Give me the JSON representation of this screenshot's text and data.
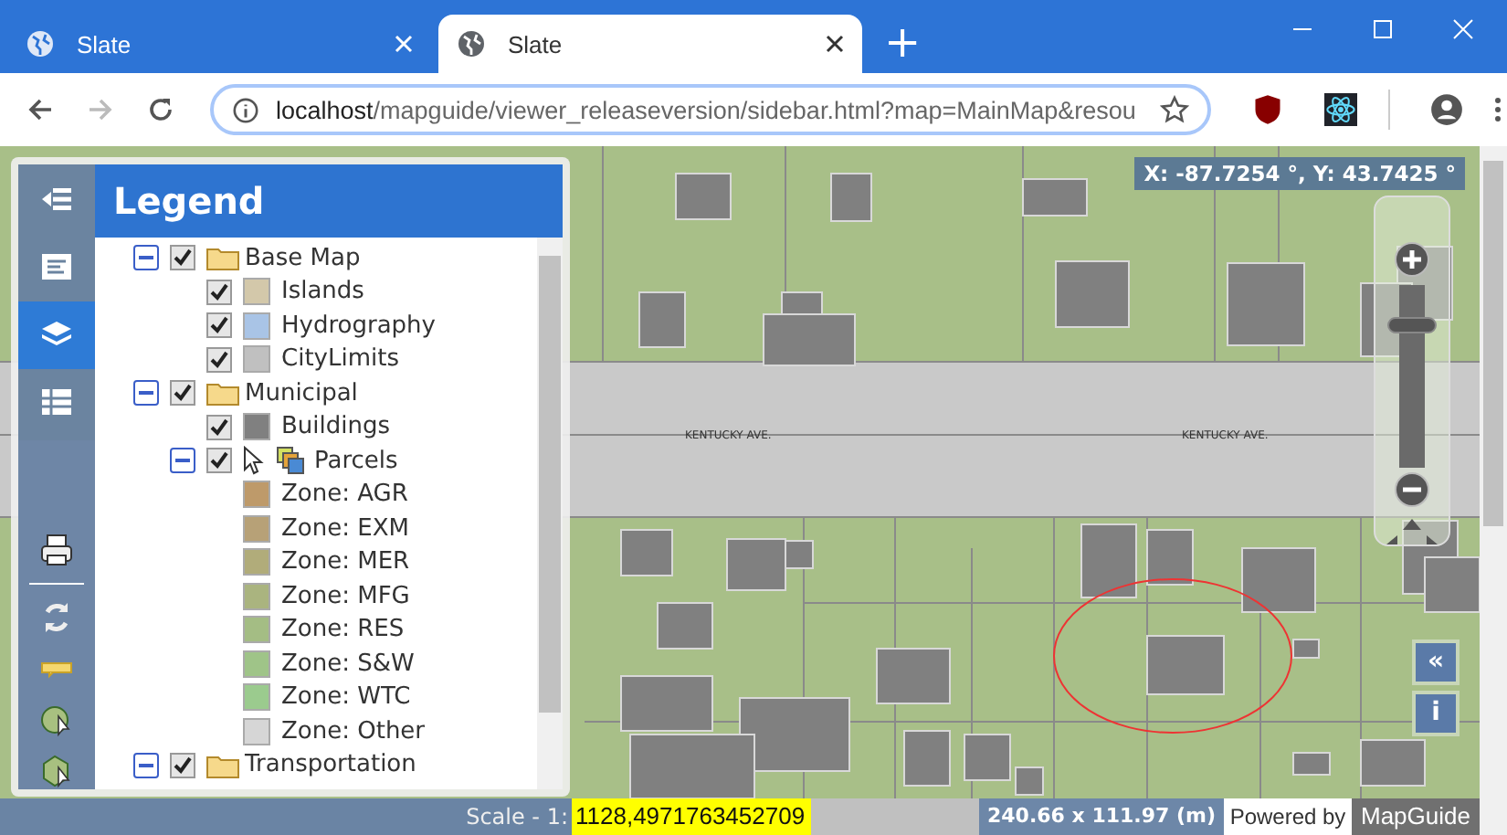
{
  "browser": {
    "tabs": [
      {
        "title": "Slate",
        "selected": false
      },
      {
        "title": "Slate",
        "selected": true
      }
    ],
    "new_tab": "+",
    "url": {
      "host": "localhost",
      "path": "/mapguide/viewer_releaseversion/sidebar.html?map=MainMap&resou"
    }
  },
  "sidebar": {
    "buttons": [
      {
        "kind": "collapse",
        "selected": false
      },
      {
        "kind": "info",
        "selected": false
      },
      {
        "kind": "layers",
        "selected": true
      },
      {
        "kind": "table",
        "selected": false
      }
    ],
    "tools": [
      {
        "kind": "print"
      },
      {
        "kind": "refresh"
      },
      {
        "kind": "tooltip"
      },
      {
        "kind": "select-circle"
      },
      {
        "kind": "select-polygon"
      }
    ]
  },
  "legend": {
    "title": "Legend",
    "items": [
      {
        "kind": "group",
        "label": "Base Map",
        "expanded": true,
        "checked": true,
        "children": [
          {
            "kind": "layer",
            "label": "Islands",
            "checked": true,
            "color": "#d3c8aa"
          },
          {
            "kind": "layer",
            "label": "Hydrography",
            "checked": true,
            "color": "#a9c4e6"
          },
          {
            "kind": "layer",
            "label": "CityLimits",
            "checked": true,
            "color": "#c0c0c0"
          }
        ]
      },
      {
        "kind": "group",
        "label": "Municipal",
        "expanded": true,
        "checked": true,
        "children": [
          {
            "kind": "layer",
            "label": "Buildings",
            "checked": true,
            "color": "#808080"
          },
          {
            "kind": "theme",
            "label": "Parcels",
            "expanded": true,
            "checked": true,
            "selectable": true,
            "children": [
              {
                "kind": "rule",
                "label": "Zone: AGR",
                "color": "#be9a6a"
              },
              {
                "kind": "rule",
                "label": "Zone: EXM",
                "color": "#b7a177"
              },
              {
                "kind": "rule",
                "label": "Zone: MER",
                "color": "#b1ac7a"
              },
              {
                "kind": "rule",
                "label": "Zone: MFG",
                "color": "#aab47f"
              },
              {
                "kind": "rule",
                "label": "Zone: RES",
                "color": "#a4bd84"
              },
              {
                "kind": "rule",
                "label": "Zone: S&W",
                "color": "#9fc488"
              },
              {
                "kind": "rule",
                "label": "Zone: WTC",
                "color": "#9bcb8e"
              },
              {
                "kind": "rule",
                "label": "Zone: Other",
                "color": "#d6d6d6"
              }
            ]
          }
        ]
      },
      {
        "kind": "group",
        "label": "Transportation",
        "expanded": true,
        "checked": true
      }
    ]
  },
  "map": {
    "street_labels": [
      "KENTUCKY AVE.",
      "KENTUCKY AVE."
    ],
    "coordinates": "X: -87.7254 °, Y: 43.7425 °",
    "collapse_button": "«",
    "info_button": "i"
  },
  "status_bar": {
    "scale_label": "Scale - 1:",
    "scale_value": "1128,4971763452709",
    "extent": "240.66 x 111.97 (m)",
    "powered_by": "Powered by",
    "brand": "MapGuide"
  }
}
